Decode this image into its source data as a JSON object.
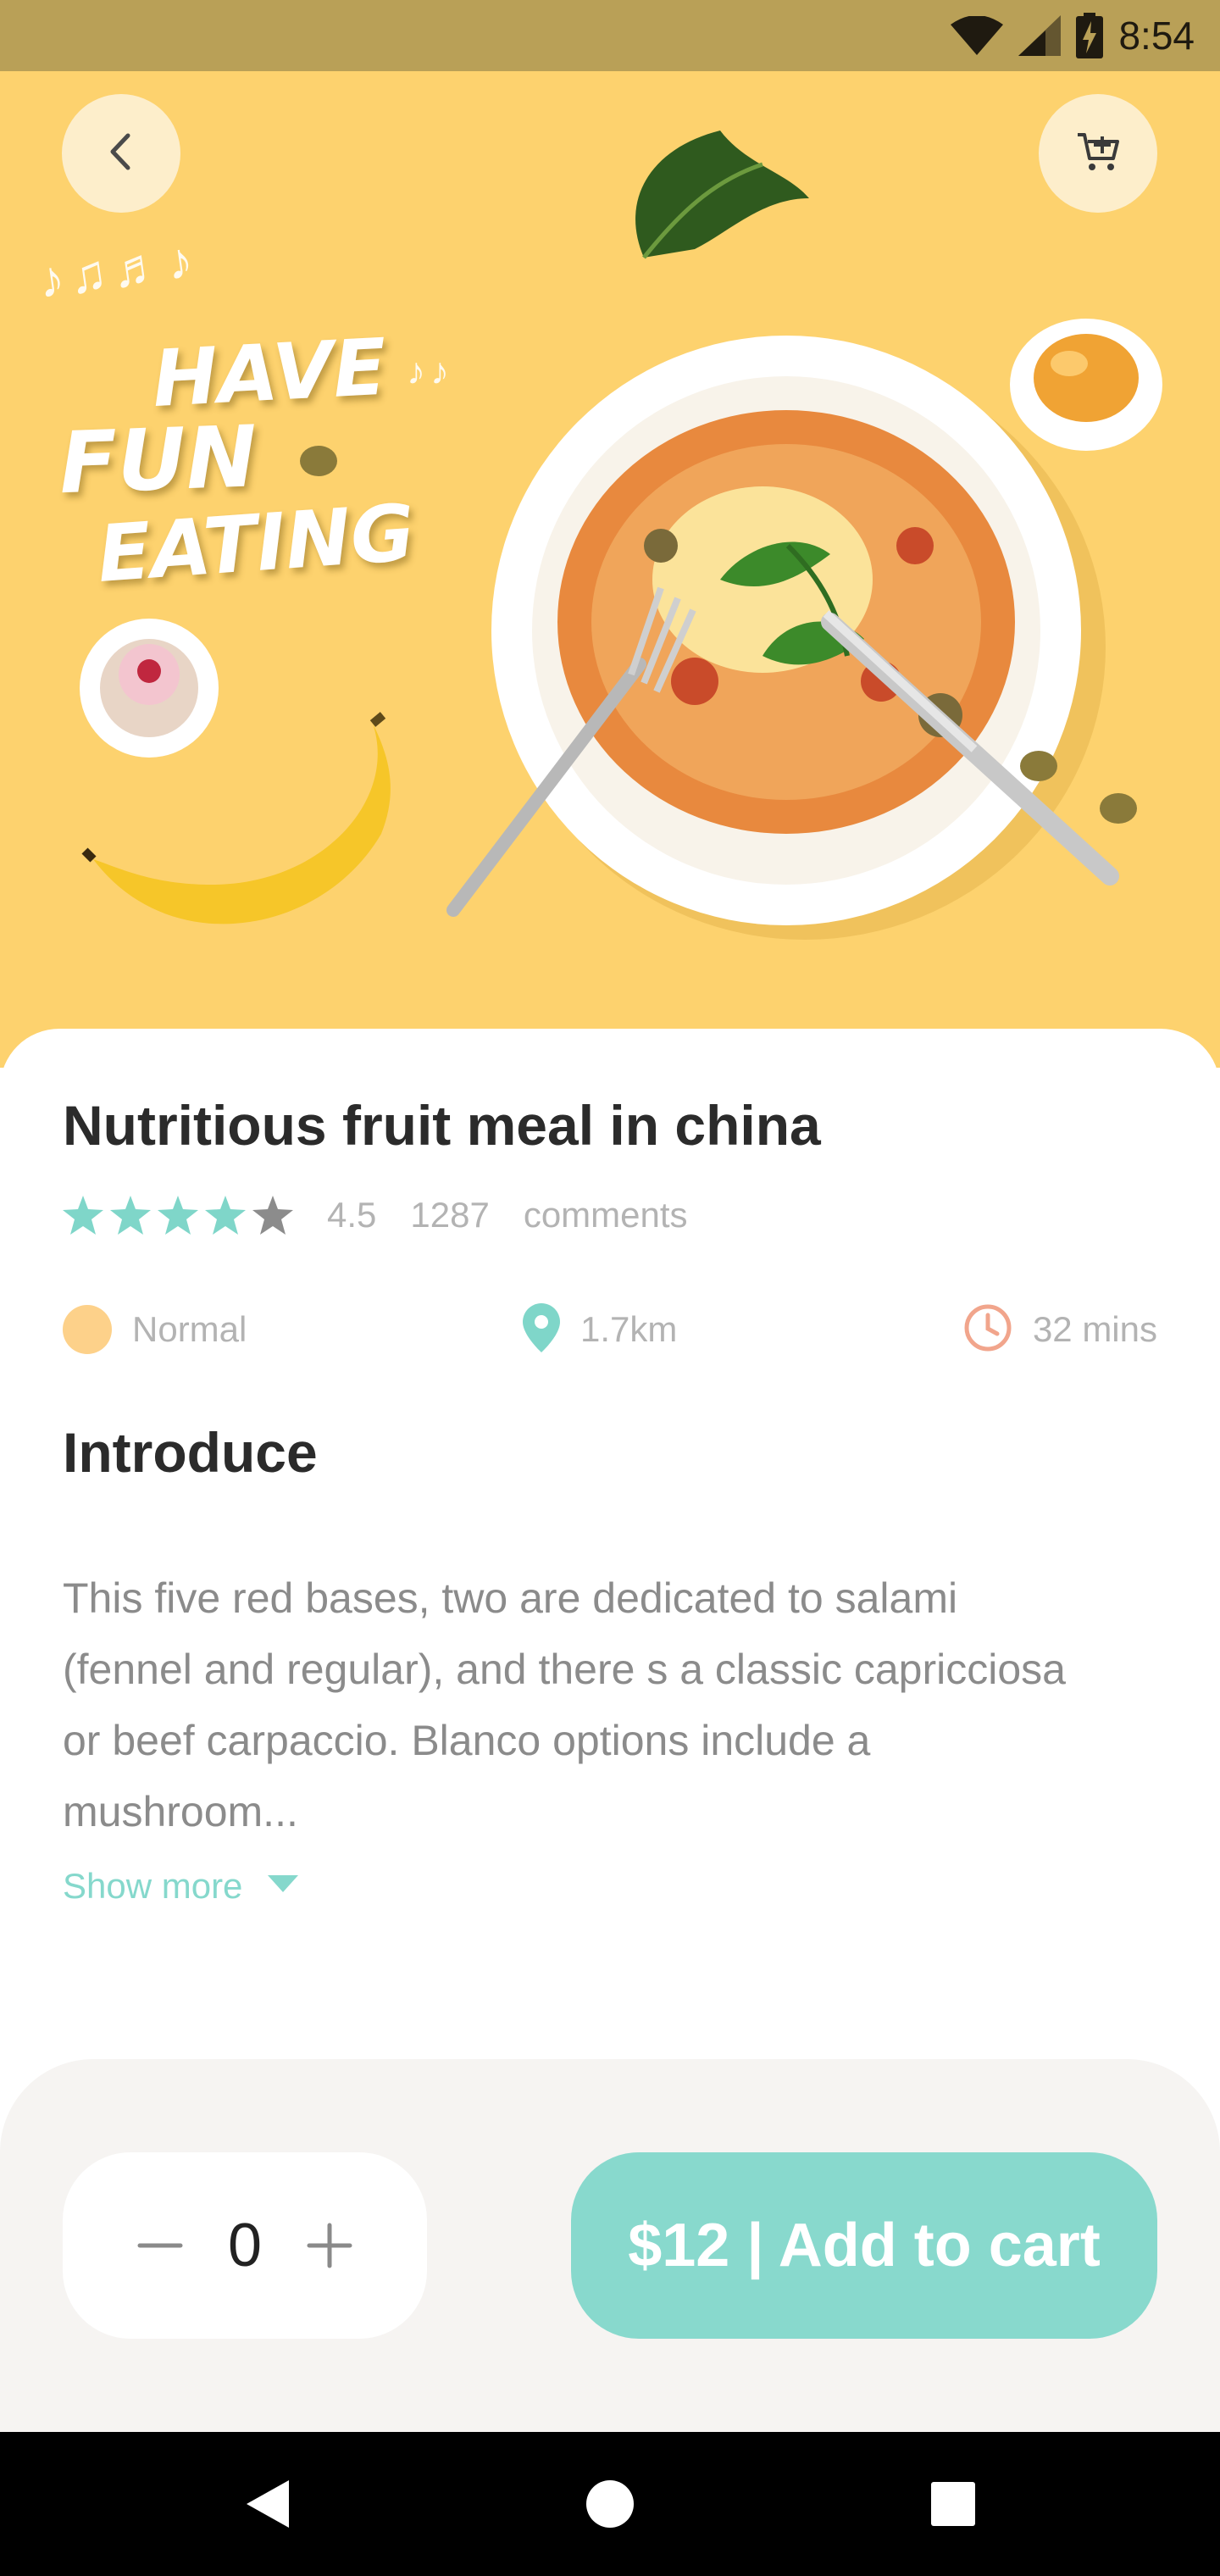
{
  "status_bar": {
    "time": "8:54",
    "icons": [
      "wifi-icon",
      "cell-signal-icon",
      "battery-charging-icon"
    ]
  },
  "hero": {
    "back_icon": "chevron-left-icon",
    "cart_icon": "cart-add-icon",
    "slogan": [
      "HAVE",
      "FUN",
      "EATING"
    ],
    "image_subject": "pasta-plate"
  },
  "dish": {
    "title": "Nutritious fruit meal in china",
    "rating": "4.5",
    "rating_value": 4.5,
    "rating_max": 5,
    "comment_count": "1287",
    "comments_label": "comments"
  },
  "meta": {
    "level": "Normal",
    "distance": "1.7km",
    "time": "32 mins"
  },
  "introduce": {
    "title": "Introduce",
    "text": "This five red bases, two are dedicated to salami (fennel and regular), and there s a classic capricciosa or beef carpaccio. Blanco options include a mushroom...",
    "show_more": "Show more"
  },
  "cart": {
    "quantity": "0",
    "button_label": "$12 | Add to cart"
  },
  "colors": {
    "accent": "#88d9cd",
    "hero_bg": "#fdd26e",
    "status_bar": "#b9a057",
    "star_active": "#7fd6c9",
    "star_inactive": "#8c8c8c",
    "clock": "#f1a58c",
    "level_dot": "#fdd18a"
  }
}
